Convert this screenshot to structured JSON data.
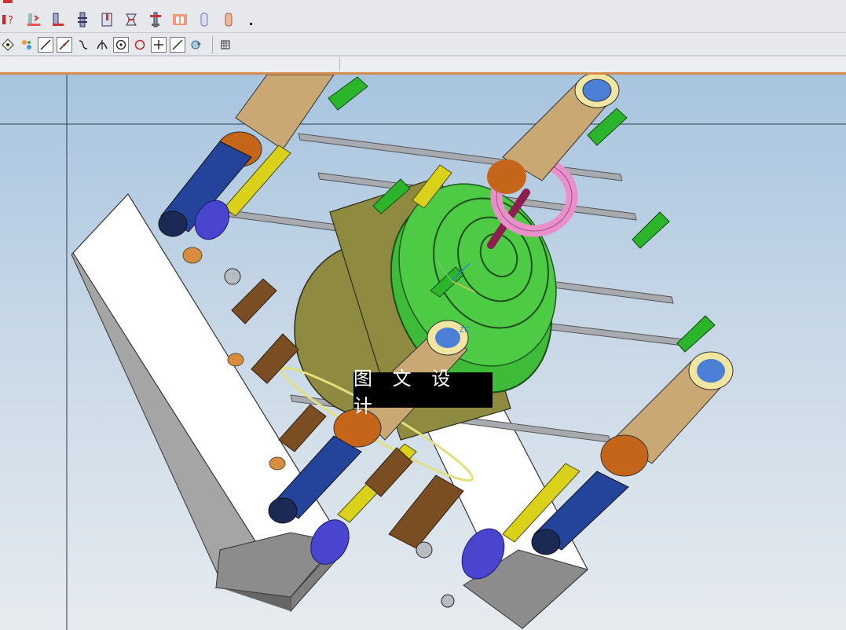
{
  "toolbar": {
    "row1_icons": [
      "help-query-icon",
      "mold-insert-icon",
      "slider-icon",
      "ejector-pin-icon",
      "standard-part-icon",
      "cooling-icon",
      "electrode-icon",
      "pocket-icon",
      "sub-insert-icon",
      "runner-icon",
      "more-dropdown-icon"
    ],
    "row2_icons": [
      "snap-point-icon",
      "snap-settings-icon",
      "line-endpoint-icon",
      "line-midpoint-icon",
      "curve-icon",
      "intersection-icon",
      "arc-center-icon",
      "quadrant-icon",
      "point-on-line-icon",
      "point-on-curve-icon",
      "face-point-icon",
      "bounded-grid-icon"
    ]
  },
  "viewport": {
    "watermark_text": "图 文 设 计",
    "csys_label": "ZC",
    "colors": {
      "background_top": "#a7c4df",
      "background_bottom": "#e6ebef",
      "plate": "#ffffff",
      "green_part": "#3fbb3a",
      "olive_part": "#8e8a3f",
      "tan_guide": "#c9a873",
      "orange_collar": "#c56519",
      "blue_pin": "#23449a",
      "yellow_pin": "#d9d11a",
      "pink_ring": "#e98fc9",
      "spring": "#4a45cf",
      "rod": "#9a9ea4"
    }
  }
}
